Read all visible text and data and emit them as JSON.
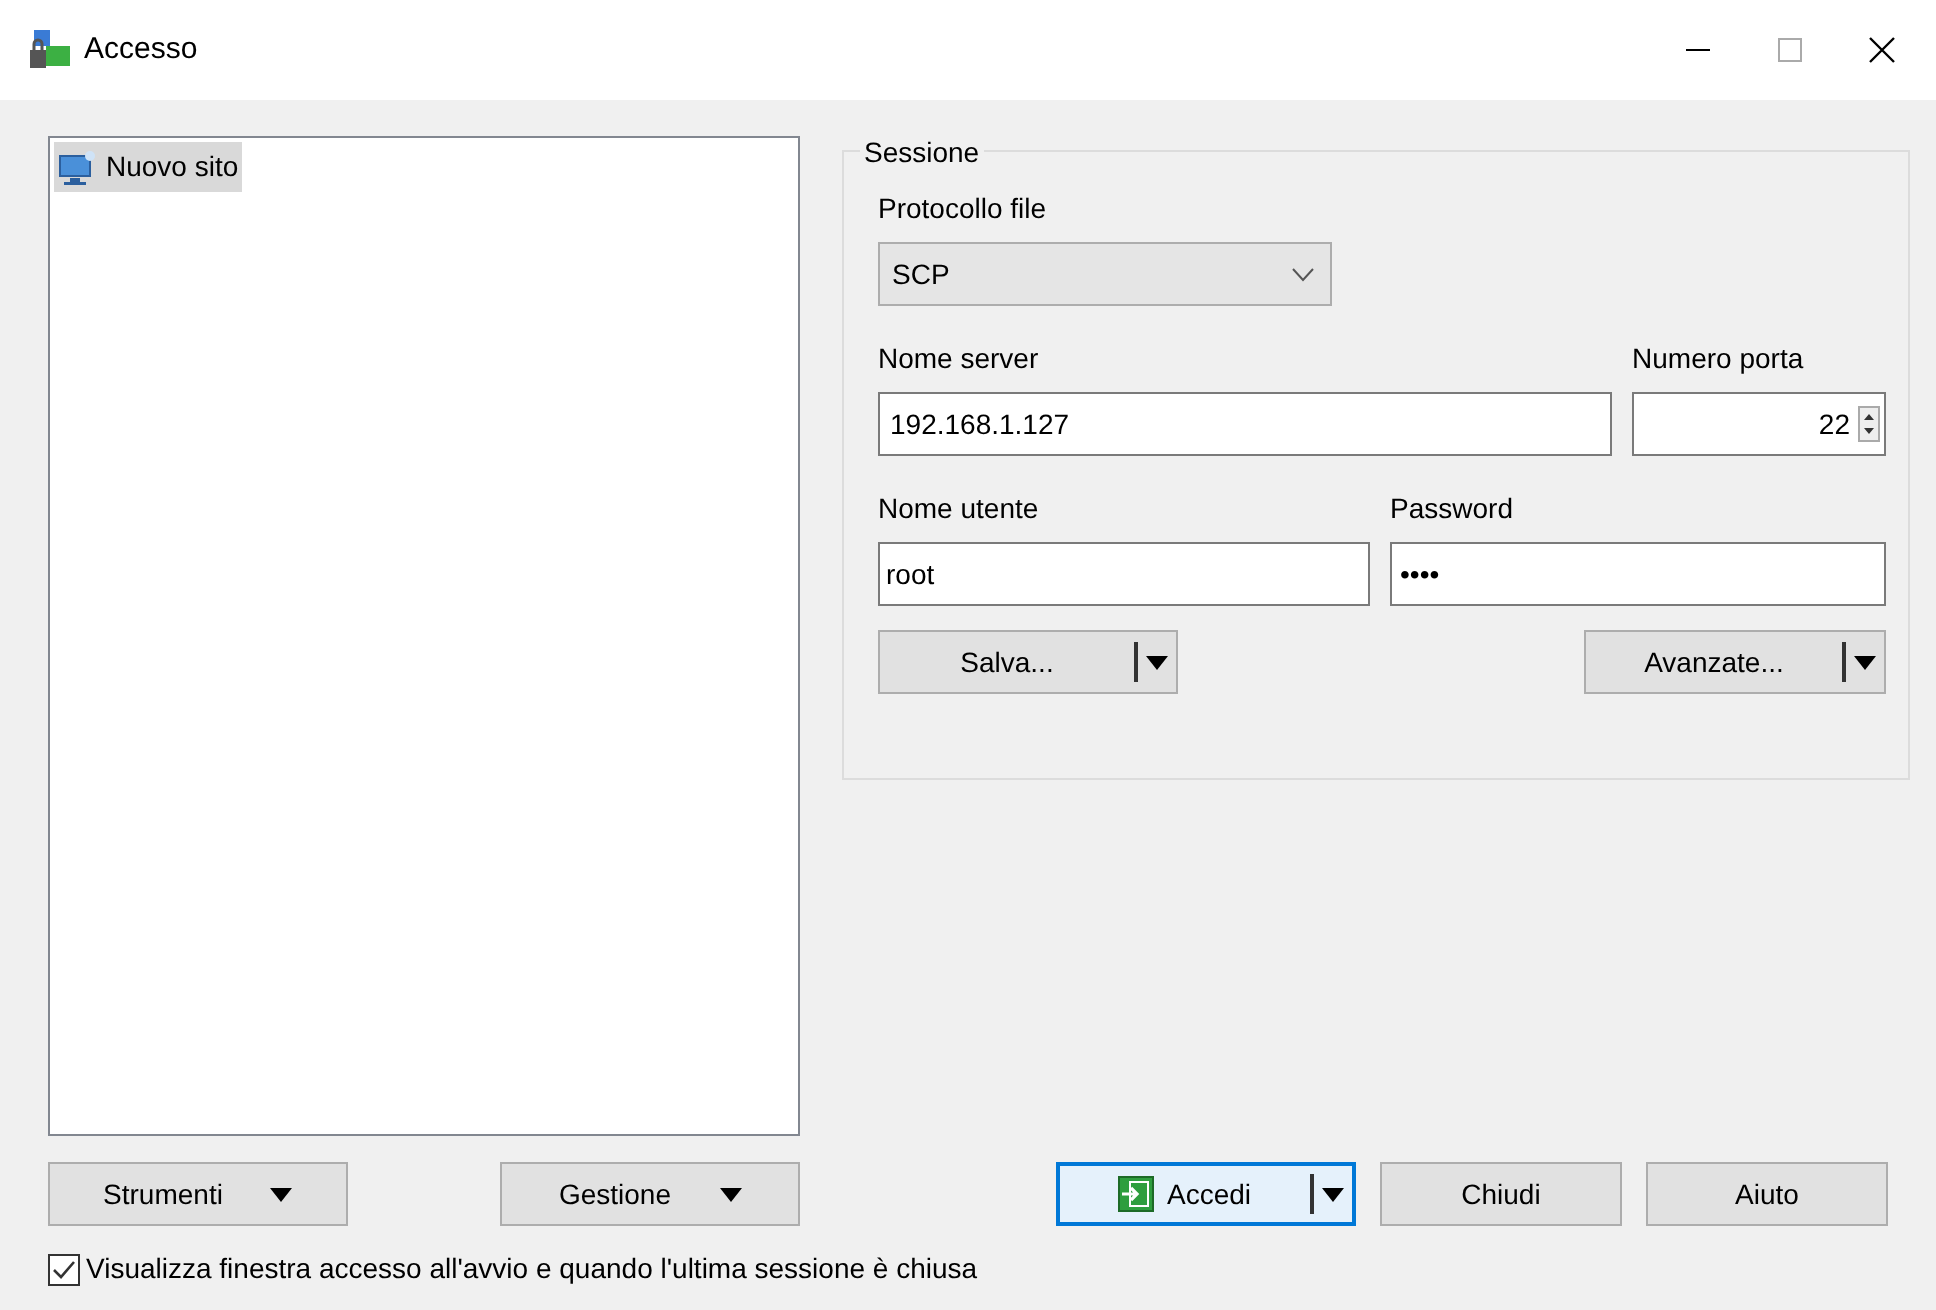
{
  "window": {
    "title": "Accesso"
  },
  "sites": [
    {
      "label": "Nuovo sito",
      "selected": true
    }
  ],
  "session": {
    "title": "Sessione",
    "protocol": {
      "label": "Protocollo file",
      "value": "SCP"
    },
    "host": {
      "label": "Nome server",
      "value": "192.168.1.127"
    },
    "port": {
      "label": "Numero porta",
      "value": "22"
    },
    "user": {
      "label": "Nome utente",
      "value": "root"
    },
    "password": {
      "label": "Password",
      "value": "••••"
    },
    "buttons": [
      {
        "label": "Salva..."
      },
      {
        "label": "Avanzate..."
      }
    ]
  },
  "left_buttons": [
    {
      "label": "Strumenti"
    },
    {
      "label": "Gestione"
    }
  ],
  "dialog_buttons": [
    {
      "label": "Accedi",
      "kind": "default"
    },
    {
      "label": "Chiudi",
      "kind": "plain"
    },
    {
      "label": "Aiuto",
      "kind": "plain"
    }
  ],
  "startup_option": {
    "label": "Visualizza finestra accesso all'avvio e quando l'ultima sessione è chiusa",
    "checked": true
  }
}
